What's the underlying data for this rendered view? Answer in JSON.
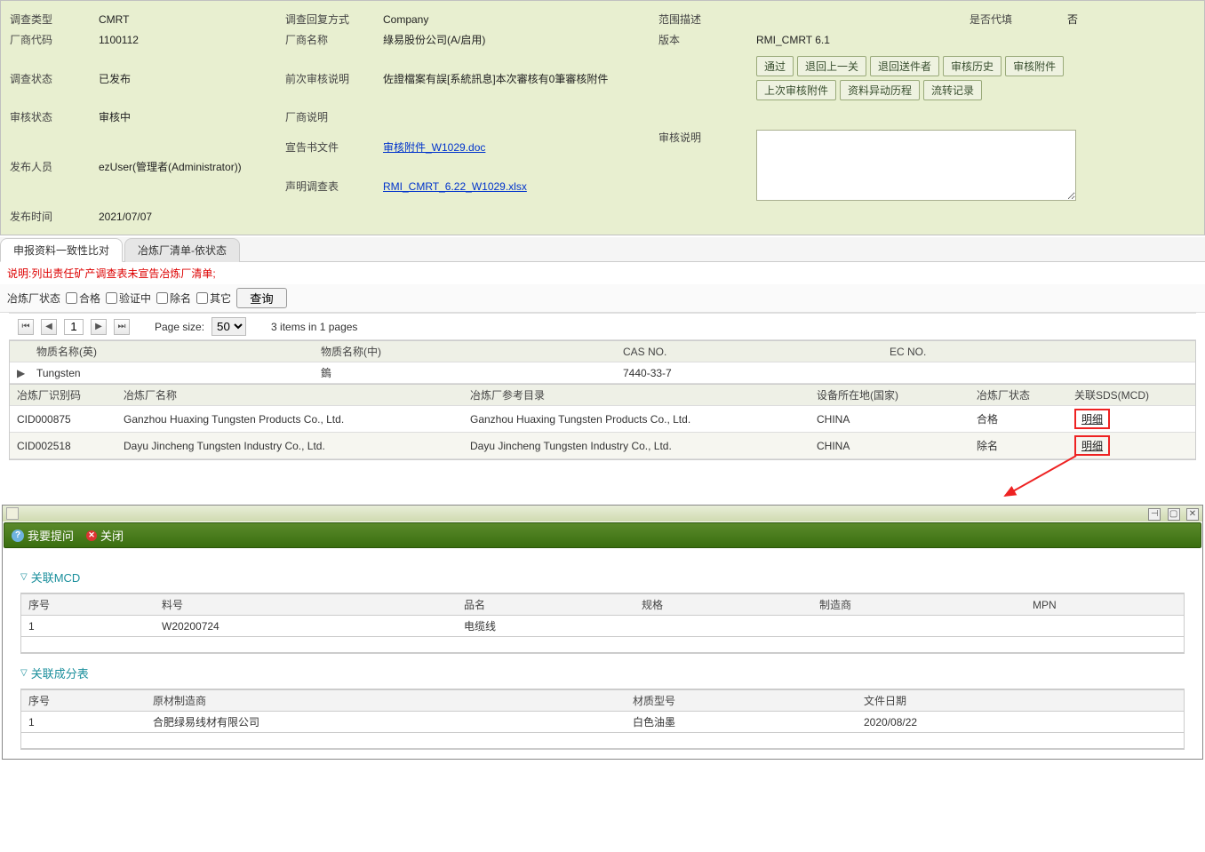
{
  "header": {
    "labels": {
      "investigation_type": "调查类型",
      "reply_method": "调查回复方式",
      "scope_desc": "范围描述",
      "substitute": "是否代填",
      "vendor_code": "厂商代码",
      "vendor_name": "厂商名称",
      "version": "版本",
      "investigation_status": "调查状态",
      "last_review_desc": "前次审核说明",
      "review_status": "审核状态",
      "vendor_desc": "厂商说明",
      "publisher": "发布人员",
      "declaration_file": "宣告书文件",
      "statement_form": "声明调查表",
      "review_desc": "审核说明",
      "publish_time": "发布时间"
    },
    "values": {
      "investigation_type": "CMRT",
      "reply_method": "Company",
      "scope_desc": "",
      "substitute": "否",
      "vendor_code": "1100112",
      "vendor_name": "綠易股份公司(A/启用)",
      "version": "RMI_CMRT 6.1",
      "investigation_status": "已发布",
      "last_review_desc": "佐證檔案有誤[系統訊息]本次審核有0筆審核附件",
      "review_status": "审核中",
      "vendor_desc": "",
      "publisher": "ezUser(管理者(Administrator))",
      "declaration_file": "审核附件_W1029.doc",
      "statement_form": "RMI_CMRT_6.22_W1029.xlsx",
      "publish_time": "2021/07/07"
    },
    "buttons": [
      "通过",
      "退回上一关",
      "退回送件者",
      "审核历史",
      "审核附件",
      "上次审核附件",
      "资料异动历程",
      "流转记录"
    ]
  },
  "tabs": {
    "items": [
      "申报资料一致性比对",
      "冶炼厂清单-依状态"
    ],
    "active": 0
  },
  "note": "说明:列出责任矿产调查表未宣告冶炼厂清单;",
  "filter": {
    "label": "冶炼厂状态",
    "options": [
      "合格",
      "验证中",
      "除名",
      "其它"
    ],
    "query": "查询"
  },
  "pager": {
    "page": "1",
    "page_size_label": "Page size:",
    "page_size": "50",
    "summary": "3 items in 1 pages"
  },
  "grid1": {
    "cols": [
      "物质名称(英)",
      "物质名称(中)",
      "CAS NO.",
      "EC NO."
    ],
    "row": [
      "Tungsten",
      "鎢",
      "7440-33-7",
      ""
    ]
  },
  "grid2": {
    "cols": [
      "冶炼厂识别码",
      "冶炼厂名称",
      "冶炼厂参考目录",
      "设备所在地(国家)",
      "冶炼厂状态",
      "关联SDS(MCD)"
    ],
    "rows": [
      [
        "CID000875",
        "Ganzhou Huaxing Tungsten Products Co., Ltd.",
        "Ganzhou Huaxing Tungsten Products Co., Ltd.",
        "CHINA",
        "合格",
        "明细"
      ],
      [
        "CID002518",
        "Dayu Jincheng Tungsten Industry Co., Ltd.",
        "Dayu Jincheng Tungsten Industry Co., Ltd.",
        "CHINA",
        "除名",
        "明细"
      ]
    ]
  },
  "subwin": {
    "toolbar": {
      "ask": "我要提问",
      "close": "关闭"
    },
    "section_mcd": "关联MCD",
    "mcd_cols": [
      "序号",
      "料号",
      "品名",
      "规格",
      "制造商",
      "MPN"
    ],
    "mcd_row": [
      "1",
      "W20200724",
      "电缆线",
      "",
      "",
      ""
    ],
    "section_comp": "关联成分表",
    "comp_cols": [
      "序号",
      "原材制造商",
      "材质型号",
      "文件日期"
    ],
    "comp_row": [
      "1",
      "合肥绿易线材有限公司",
      "白色油墨",
      "2020/08/22"
    ]
  }
}
